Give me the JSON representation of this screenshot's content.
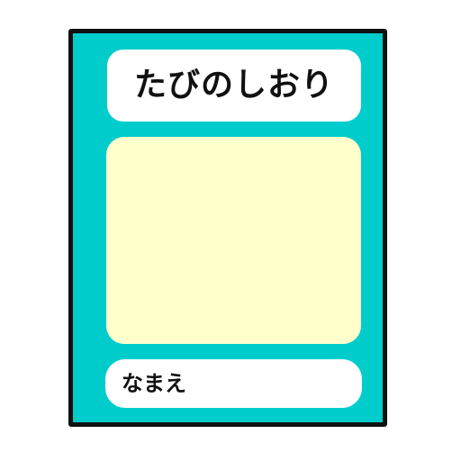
{
  "booklet": {
    "title": "たびのしおり",
    "name_label": "なまえ"
  },
  "colors": {
    "background": "#ffffff",
    "cover": "#00cccc",
    "border": "#111111",
    "title_box": "#ffffff",
    "picture_area": "#ffffcc",
    "name_box": "#ffffff",
    "text": "#111111"
  }
}
